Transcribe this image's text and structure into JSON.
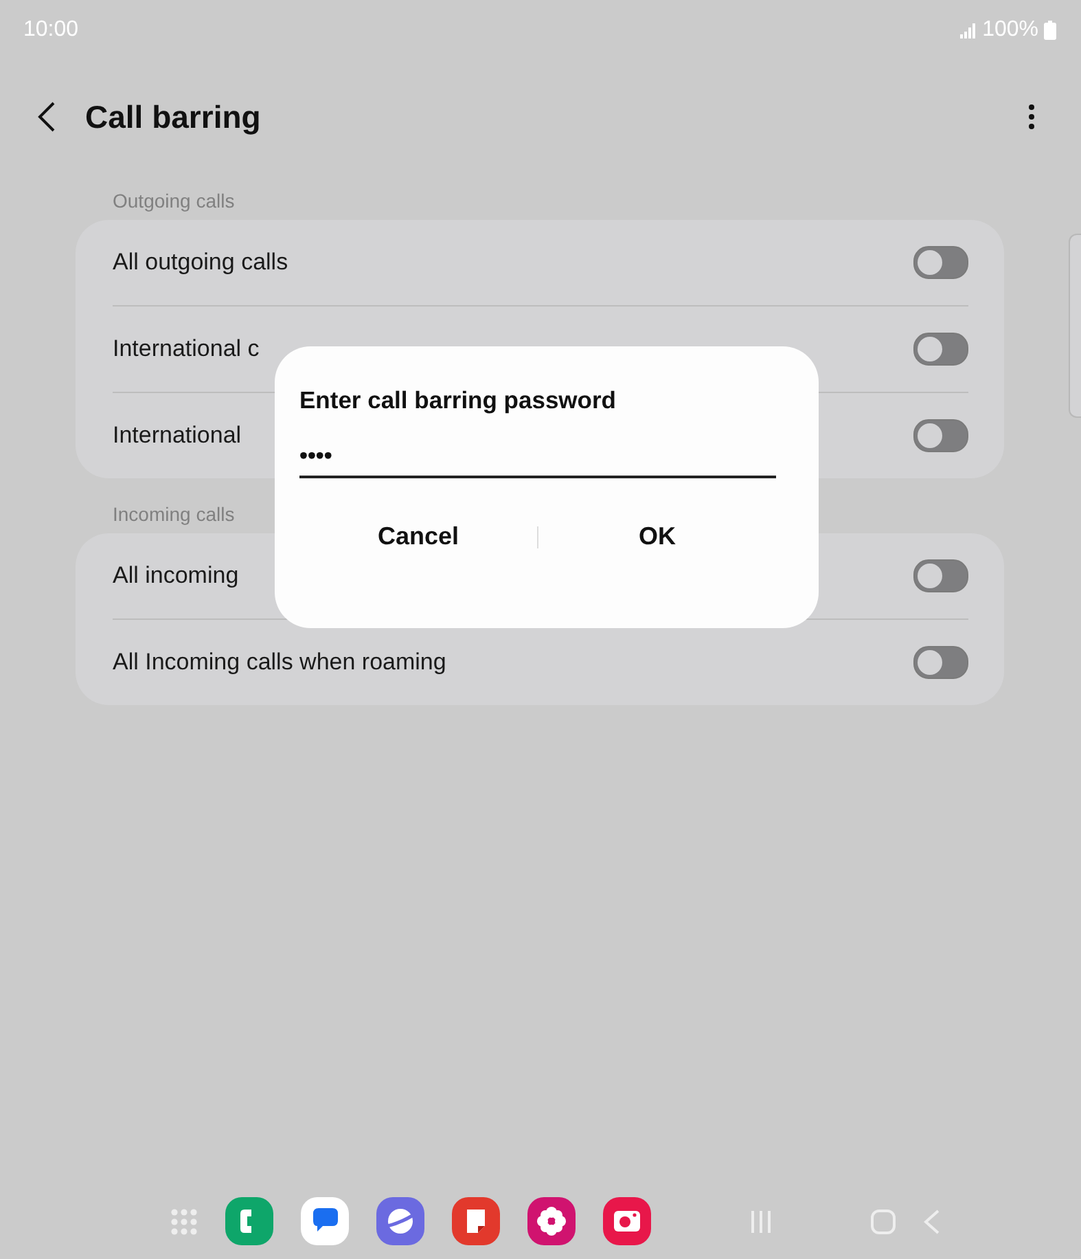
{
  "status_bar": {
    "time": "10:00",
    "battery": "100%"
  },
  "header": {
    "title": "Call barring"
  },
  "sections": [
    {
      "title": "Outgoing calls",
      "items": [
        {
          "label": "All outgoing calls",
          "on": false
        },
        {
          "label": "International c",
          "on": false
        },
        {
          "label": "International",
          "on": false
        }
      ]
    },
    {
      "title": "Incoming calls",
      "items": [
        {
          "label": "All incoming",
          "on": false
        },
        {
          "label": "All Incoming calls when roaming",
          "on": false
        }
      ]
    }
  ],
  "dialog": {
    "title": "Enter call barring password",
    "value": "••••",
    "buttons": [
      "Cancel",
      "OK"
    ]
  }
}
